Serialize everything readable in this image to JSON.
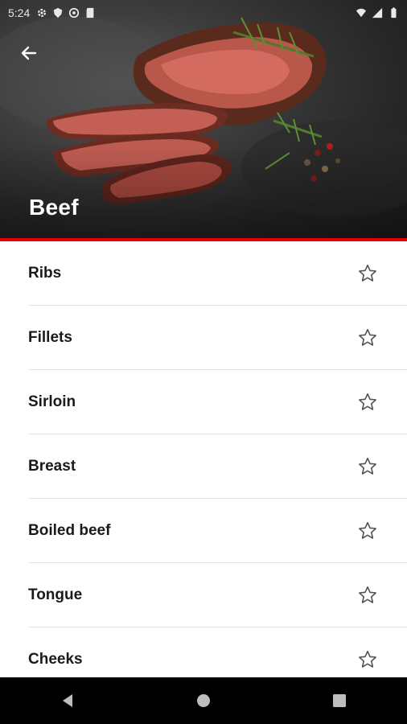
{
  "status_bar": {
    "time": "5:24",
    "icons_left": [
      "settings-icon",
      "shield-icon",
      "at-icon",
      "sd-card-icon"
    ],
    "icons_right": [
      "wifi-icon",
      "signal-icon",
      "battery-icon"
    ]
  },
  "header": {
    "title": "Beef",
    "back_icon": "arrow-left-icon",
    "accent_color": "#e3000b"
  },
  "list": {
    "items": [
      {
        "label": "Ribs"
      },
      {
        "label": "Fillets"
      },
      {
        "label": "Sirloin"
      },
      {
        "label": "Breast"
      },
      {
        "label": "Boiled beef"
      },
      {
        "label": "Tongue"
      },
      {
        "label": "Cheeks"
      }
    ],
    "favorite_icon": "star-outline-icon"
  },
  "navigation_bar": {
    "buttons": [
      "back-triangle-icon",
      "home-circle-icon",
      "recents-square-icon"
    ]
  }
}
